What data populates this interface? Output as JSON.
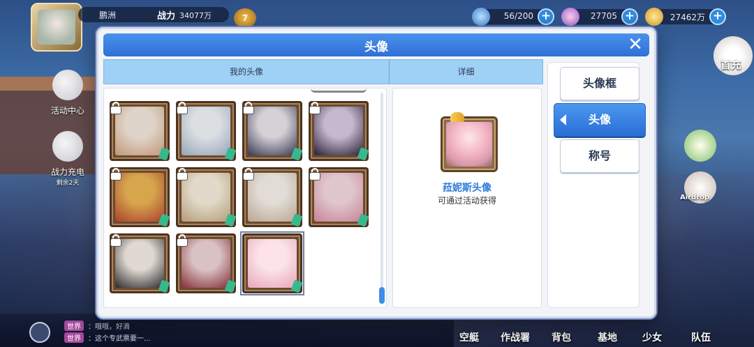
{
  "hud": {
    "player_name": "鹏洲",
    "power_label": "战力",
    "power_value": "34077万",
    "rank": "7",
    "resources": [
      {
        "icon": "energy-icon",
        "value": "56/200"
      },
      {
        "icon": "diamond-icon",
        "value": "27705"
      },
      {
        "icon": "gold-coin-icon",
        "value": "27462万"
      }
    ]
  },
  "side_left": [
    {
      "label": "活动中心",
      "sub": ""
    },
    {
      "label": "战力充电",
      "sub": "剩余2天"
    }
  ],
  "side_right": {
    "first_charge_label": "首充",
    "airdrop_label": "Airdrop"
  },
  "chat": [
    {
      "tag": "世界",
      "text": "：哦哦，好滴"
    },
    {
      "tag": "世界",
      "text": "：这个专武票要一..."
    }
  ],
  "bottom_nav": [
    "空艇",
    "作战署",
    "背包",
    "基地",
    "少女",
    "队伍"
  ],
  "modal": {
    "title": "头像",
    "close_glyph": "✕",
    "tabs": {
      "my_avatars": "我的头像",
      "details": "详细"
    },
    "side_buttons": [
      "头像框",
      "头像",
      "称号"
    ],
    "active_side_button": 1,
    "detail": {
      "name": "菈妮斯头像",
      "description": "可通过活动获得"
    },
    "avatars": [
      {
        "locked": true,
        "colors": [
          "#f4e6d8",
          "#d9a27a"
        ]
      },
      {
        "locked": true,
        "colors": [
          "#eef2f7",
          "#9fb3cc"
        ]
      },
      {
        "locked": true,
        "colors": [
          "#e8e2ea",
          "#3a3a5a"
        ]
      },
      {
        "locked": true,
        "colors": [
          "#d9c8e4",
          "#2b1f3b"
        ]
      },
      {
        "locked": true,
        "colors": [
          "#f2b441",
          "#c9402c"
        ]
      },
      {
        "locked": true,
        "colors": [
          "#f7ecd8",
          "#c7a97a"
        ]
      },
      {
        "locked": true,
        "colors": [
          "#f6efe6",
          "#cbb49a"
        ]
      },
      {
        "locked": true,
        "colors": [
          "#f6d7de",
          "#e48aa4"
        ]
      },
      {
        "locked": true,
        "colors": [
          "#f3ece2",
          "#2c2a30"
        ]
      },
      {
        "locked": true,
        "colors": [
          "#f1d2d4",
          "#9c2f3a"
        ]
      },
      {
        "locked": false,
        "colors": [
          "#fbe3e8",
          "#e9a5b8"
        ]
      }
    ]
  }
}
